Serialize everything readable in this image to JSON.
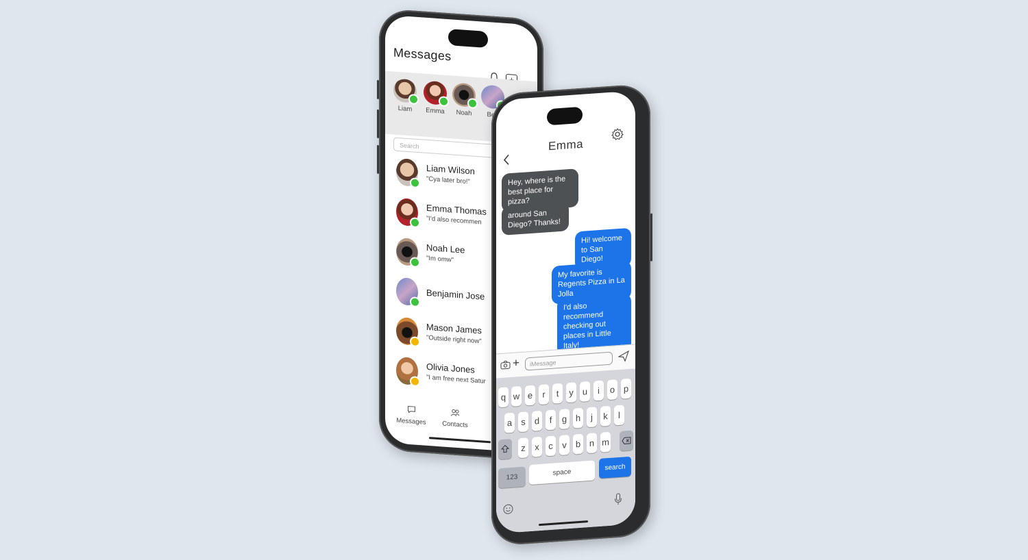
{
  "messages_app": {
    "title": "Messages",
    "stories": [
      {
        "name": "Liam",
        "status": "online"
      },
      {
        "name": "Emma",
        "status": "online"
      },
      {
        "name": "Noah",
        "status": "online"
      },
      {
        "name": "Ben",
        "status": "online"
      }
    ],
    "search_placeholder": "Search",
    "conversations": [
      {
        "name": "Liam Wilson",
        "preview": "\"Cya later bro!\"",
        "status": "online"
      },
      {
        "name": "Emma Thomas",
        "preview": "\"I'd also recommen",
        "status": "online"
      },
      {
        "name": "Noah Lee",
        "preview": "\"Im omw\"",
        "status": "online"
      },
      {
        "name": "Benjamin Jose",
        "preview": "",
        "status": "online"
      },
      {
        "name": "Mason James",
        "preview": "\"Outside right now\"",
        "status": "away"
      },
      {
        "name": "Olivia Jones",
        "preview": "\"I am free next Satur",
        "status": "away"
      }
    ],
    "tabs": [
      {
        "label": "Messages",
        "icon": "chat-bubble-icon"
      },
      {
        "label": "Contacts",
        "icon": "people-icon"
      }
    ]
  },
  "chat_app": {
    "contact_name": "Emma",
    "messages": [
      {
        "from": "them",
        "text": "Hey, where is the best place for pizza?"
      },
      {
        "from": "them",
        "text": "around San Diego? Thanks!"
      },
      {
        "from": "me",
        "text": "Hi! welcome to San Diego!"
      },
      {
        "from": "me",
        "text": "My favorite is Regents Pizza in La Jolla"
      },
      {
        "from": "me",
        "text": "I'd also recommend checking out places in Little Italy!"
      }
    ],
    "input_placeholder": "iMessage",
    "keyboard": {
      "row1": [
        "q",
        "w",
        "e",
        "r",
        "t",
        "y",
        "u",
        "i",
        "o",
        "p"
      ],
      "row2": [
        "a",
        "s",
        "d",
        "f",
        "g",
        "h",
        "j",
        "k",
        "l"
      ],
      "row3": [
        "z",
        "x",
        "c",
        "v",
        "b",
        "n",
        "m"
      ],
      "numbers_key": "123",
      "space_key": "space",
      "action_key": "search"
    }
  },
  "colors": {
    "background": "#dfe6ee",
    "sent_bubble": "#1d74e8",
    "received_bubble": "#4e5154",
    "online": "#3cc23c",
    "away": "#f2b705"
  }
}
